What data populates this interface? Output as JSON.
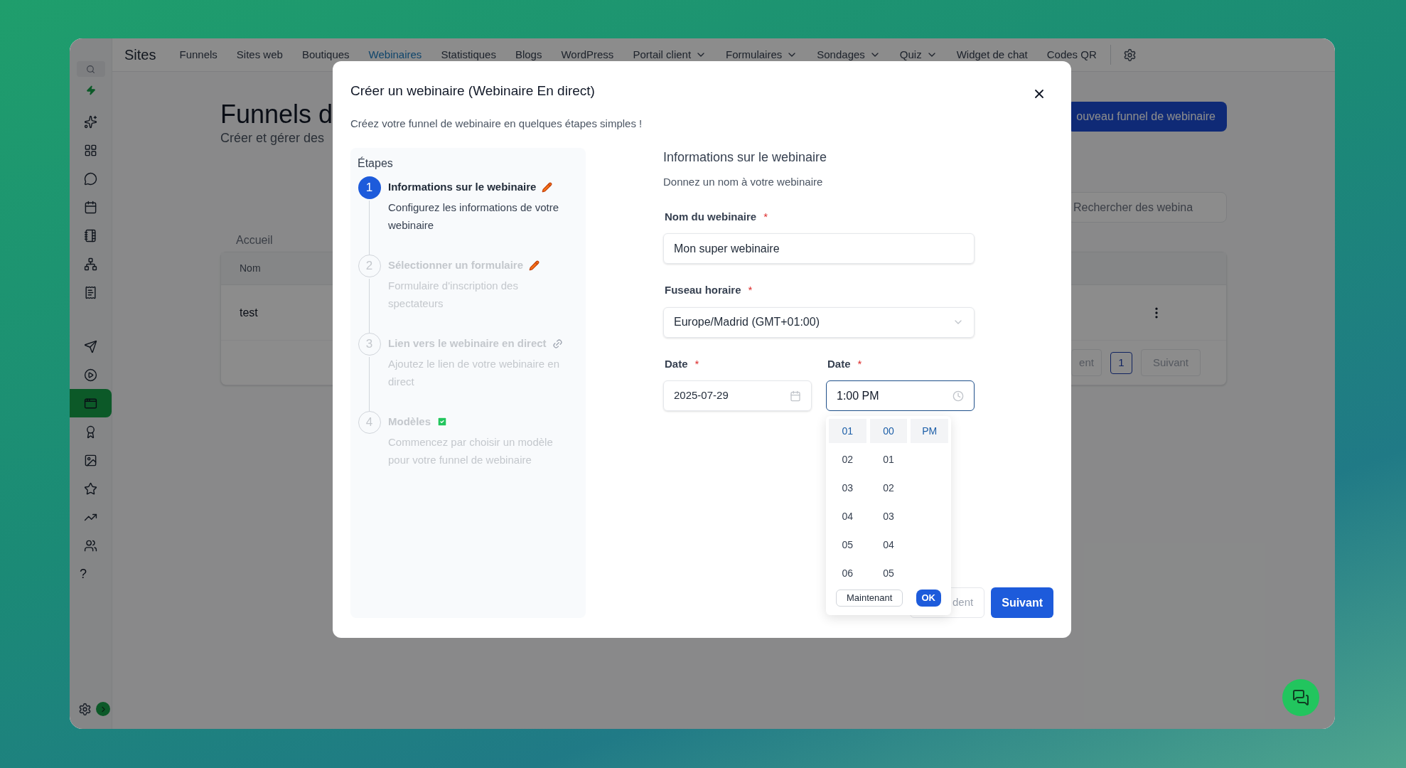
{
  "nav": {
    "title": "Sites",
    "items": [
      {
        "label": "Funnels",
        "selected": false,
        "dropdown": false
      },
      {
        "label": "Sites web",
        "selected": false,
        "dropdown": false
      },
      {
        "label": "Boutiques",
        "selected": false,
        "dropdown": false
      },
      {
        "label": "Webinaires",
        "selected": true,
        "dropdown": false
      },
      {
        "label": "Statistiques",
        "selected": false,
        "dropdown": false
      },
      {
        "label": "Blogs",
        "selected": false,
        "dropdown": false
      },
      {
        "label": "WordPress",
        "selected": false,
        "dropdown": false
      },
      {
        "label": "Portail client",
        "selected": false,
        "dropdown": true
      },
      {
        "label": "Formulaires",
        "selected": false,
        "dropdown": true
      },
      {
        "label": "Sondages",
        "selected": false,
        "dropdown": true
      },
      {
        "label": "Quiz",
        "selected": false,
        "dropdown": true
      },
      {
        "label": "Widget de chat",
        "selected": false,
        "dropdown": false
      },
      {
        "label": "Codes QR",
        "selected": false,
        "dropdown": false
      }
    ]
  },
  "sidebar": {
    "groups": [
      [
        {
          "selected": false
        },
        {
          "selected": false
        },
        {
          "selected": false
        },
        {
          "selected": false
        },
        {
          "selected": false
        },
        {
          "selected": false
        },
        {
          "selected": false
        }
      ],
      [
        {
          "selected": false
        },
        {
          "selected": false
        },
        {
          "selected": true
        },
        {
          "selected": false
        },
        {
          "selected": false
        },
        {
          "selected": false
        },
        {
          "selected": false
        },
        {
          "selected": false
        }
      ]
    ],
    "help": "?"
  },
  "page": {
    "title": "Funnels d",
    "subtitle": "Créer et gérer des",
    "new_button": "ouveau funnel de webinaire",
    "search": {
      "placeholder": "Rechercher des webina"
    },
    "breadcrumb": "Accueil",
    "table": {
      "columns": [
        "Nom"
      ],
      "rows": [
        [
          "test"
        ]
      ]
    },
    "pagination": {
      "previous": "ent",
      "pages": [
        {
          "label": "1",
          "selected": true
        }
      ],
      "next": "Suivant"
    }
  },
  "modal": {
    "title": "Créer un webinaire (Webinaire En direct)",
    "subtitle": "Créez votre funnel de webinaire en quelques étapes simples !",
    "steps_title": "Étapes",
    "steps": [
      {
        "number": "1",
        "title": "Informations sur le webinaire",
        "description": "Configurez les informations de votre webinaire",
        "kind": "edit",
        "selected": true
      },
      {
        "number": "2",
        "title": "Sélectionner un formulaire",
        "description": "Formulaire d'inscription des spectateurs",
        "kind": "edit",
        "selected": false
      },
      {
        "number": "3",
        "title": "Lien vers le webinaire en direct",
        "description": "Ajoutez le lien de votre webinaire en direct",
        "kind": "link",
        "selected": false
      },
      {
        "number": "4",
        "title": "Modèles",
        "description": "Commencez par choisir un modèle pour votre funnel de webinaire",
        "kind": "template",
        "selected": false
      }
    ],
    "form": {
      "title": "Informations sur le webinaire",
      "subtitle": "Donnez un nom à votre webinaire",
      "rows": [
        [
          {
            "kind": "text",
            "label": "Nom du webinaire",
            "required_mark": "*",
            "value": "Mon super webinaire",
            "focused": false
          }
        ],
        [
          {
            "kind": "select",
            "label": "Fuseau horaire",
            "required_mark": "*",
            "value": "Europe/Madrid (GMT+01:00)",
            "focused": false
          }
        ],
        [
          {
            "kind": "date",
            "label": "Date",
            "required_mark": "*",
            "value": "2025-07-29",
            "focused": false
          },
          {
            "kind": "time",
            "label": "Date",
            "required_mark": "*",
            "value": "1:00 PM",
            "focused": true
          }
        ]
      ]
    },
    "time_picker": {
      "hours": [
        {
          "label": "01",
          "selected": true
        },
        {
          "label": "02",
          "selected": false
        },
        {
          "label": "03",
          "selected": false
        },
        {
          "label": "04",
          "selected": false
        },
        {
          "label": "05",
          "selected": false
        },
        {
          "label": "06",
          "selected": false
        }
      ],
      "minutes": [
        {
          "label": "00",
          "selected": true
        },
        {
          "label": "01",
          "selected": false
        },
        {
          "label": "02",
          "selected": false
        },
        {
          "label": "03",
          "selected": false
        },
        {
          "label": "04",
          "selected": false
        },
        {
          "label": "05",
          "selected": false
        }
      ],
      "periods": [
        {
          "label": "PM",
          "selected": true
        }
      ],
      "now_button": "Maintenant",
      "ok_button": "OK"
    },
    "footer": {
      "previous": "dent",
      "next": "Suivant"
    }
  }
}
